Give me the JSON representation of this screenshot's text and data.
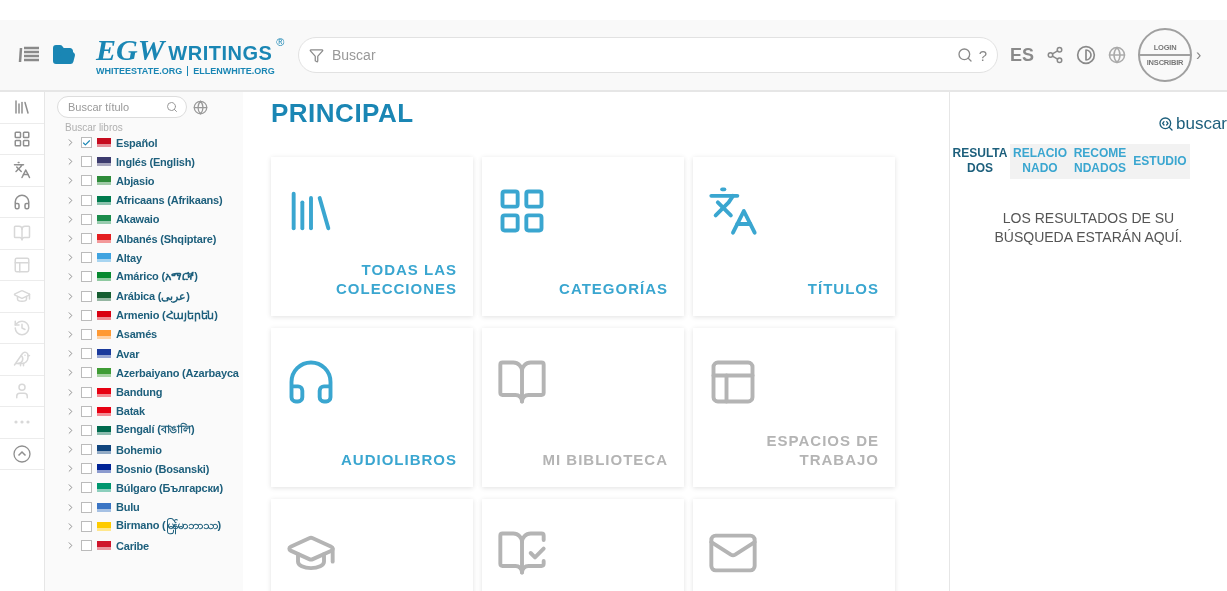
{
  "header": {
    "logo_mark": "EGW",
    "logo_word": "WRITINGS",
    "logo_reg": "®",
    "logo_links": [
      "WHITEESTATE.ORG",
      "ELLENWHITE.ORG"
    ],
    "search_placeholder": "Buscar",
    "help": "?",
    "language": "ES",
    "login": "LOGIN",
    "signup": "INSCRIBIR",
    "more": "›"
  },
  "rail": [
    {
      "enabled": true
    },
    {
      "enabled": true
    },
    {
      "enabled": true
    },
    {
      "enabled": true
    },
    {
      "enabled": false
    },
    {
      "enabled": false
    },
    {
      "enabled": false
    },
    {
      "enabled": false
    },
    {
      "enabled": false
    },
    {
      "enabled": false
    },
    {
      "enabled": false
    },
    {
      "enabled": true
    }
  ],
  "sidebar": {
    "title_placeholder": "Buscar título",
    "search_books": "Buscar libros",
    "languages": [
      {
        "name": "Español",
        "checked": true,
        "color": "#c60b1e"
      },
      {
        "name": "Inglés (English)",
        "checked": false,
        "color": "#3c3b6e"
      },
      {
        "name": "Abjasio",
        "checked": false,
        "color": "#2e8b3a"
      },
      {
        "name": "Africaans (Afrikaans)",
        "checked": false,
        "color": "#007a4d"
      },
      {
        "name": "Akawaio",
        "checked": false,
        "color": "#1c8c4c"
      },
      {
        "name": "Albanés (Shqiptare)",
        "checked": false,
        "color": "#e41e20"
      },
      {
        "name": "Altay",
        "checked": false,
        "color": "#3fa3e0"
      },
      {
        "name": "Amárico (አማርኛ)",
        "checked": false,
        "color": "#078930"
      },
      {
        "name": "Arábica (عربى)",
        "checked": false,
        "color": "#165d31"
      },
      {
        "name": "Armenio (Հայերեն)",
        "checked": false,
        "color": "#d90012"
      },
      {
        "name": "Asamés",
        "checked": false,
        "color": "#ff9933"
      },
      {
        "name": "Avar",
        "checked": false,
        "color": "#1a3a9c"
      },
      {
        "name": "Azerbaiyano (Azarbayca",
        "checked": false,
        "color": "#3f9c35"
      },
      {
        "name": "Bandung",
        "checked": false,
        "color": "#e70011"
      },
      {
        "name": "Batak",
        "checked": false,
        "color": "#e70012"
      },
      {
        "name": "Bengalí (বাঙালি)",
        "checked": false,
        "color": "#006a4e"
      },
      {
        "name": "Bohemio",
        "checked": false,
        "color": "#11457e"
      },
      {
        "name": "Bosnio (Bosanski)",
        "checked": false,
        "color": "#002395"
      },
      {
        "name": "Búlgaro (Български)",
        "checked": false,
        "color": "#00966e"
      },
      {
        "name": "Bulu",
        "checked": false,
        "color": "#3a75c4"
      },
      {
        "name": "Birmano (မြန်မာဘာသာ)",
        "checked": false,
        "color": "#fecb00"
      },
      {
        "name": "Caribe",
        "checked": false,
        "color": "#cf142b"
      }
    ]
  },
  "main": {
    "title": "PRINCIPAL",
    "tiles": [
      {
        "label": "TODAS LAS COLECCIONES",
        "enabled": true
      },
      {
        "label": "CATEGORÍAS",
        "enabled": true
      },
      {
        "label": "TÍTULOS",
        "enabled": true
      },
      {
        "label": "AUDIOLIBROS",
        "enabled": true
      },
      {
        "label": "MI BIBLIOTECA",
        "enabled": false
      },
      {
        "label": "ESPACIOS DE TRABAJO",
        "enabled": false
      },
      {
        "enabled": false
      },
      {
        "enabled": false
      },
      {
        "enabled": false
      }
    ]
  },
  "results": {
    "search_link": "buscar",
    "tabs": [
      {
        "label": "RESULTADOS",
        "selected": true
      },
      {
        "label": "RELACIONADO",
        "selected": false
      },
      {
        "label": "RECOMENDADOS",
        "selected": false
      },
      {
        "label": "ESTUDIO",
        "selected": false
      }
    ],
    "message": "LOS RESULTADOS DE SU BÚSQUEDA ESTARÁN AQUÍ."
  }
}
